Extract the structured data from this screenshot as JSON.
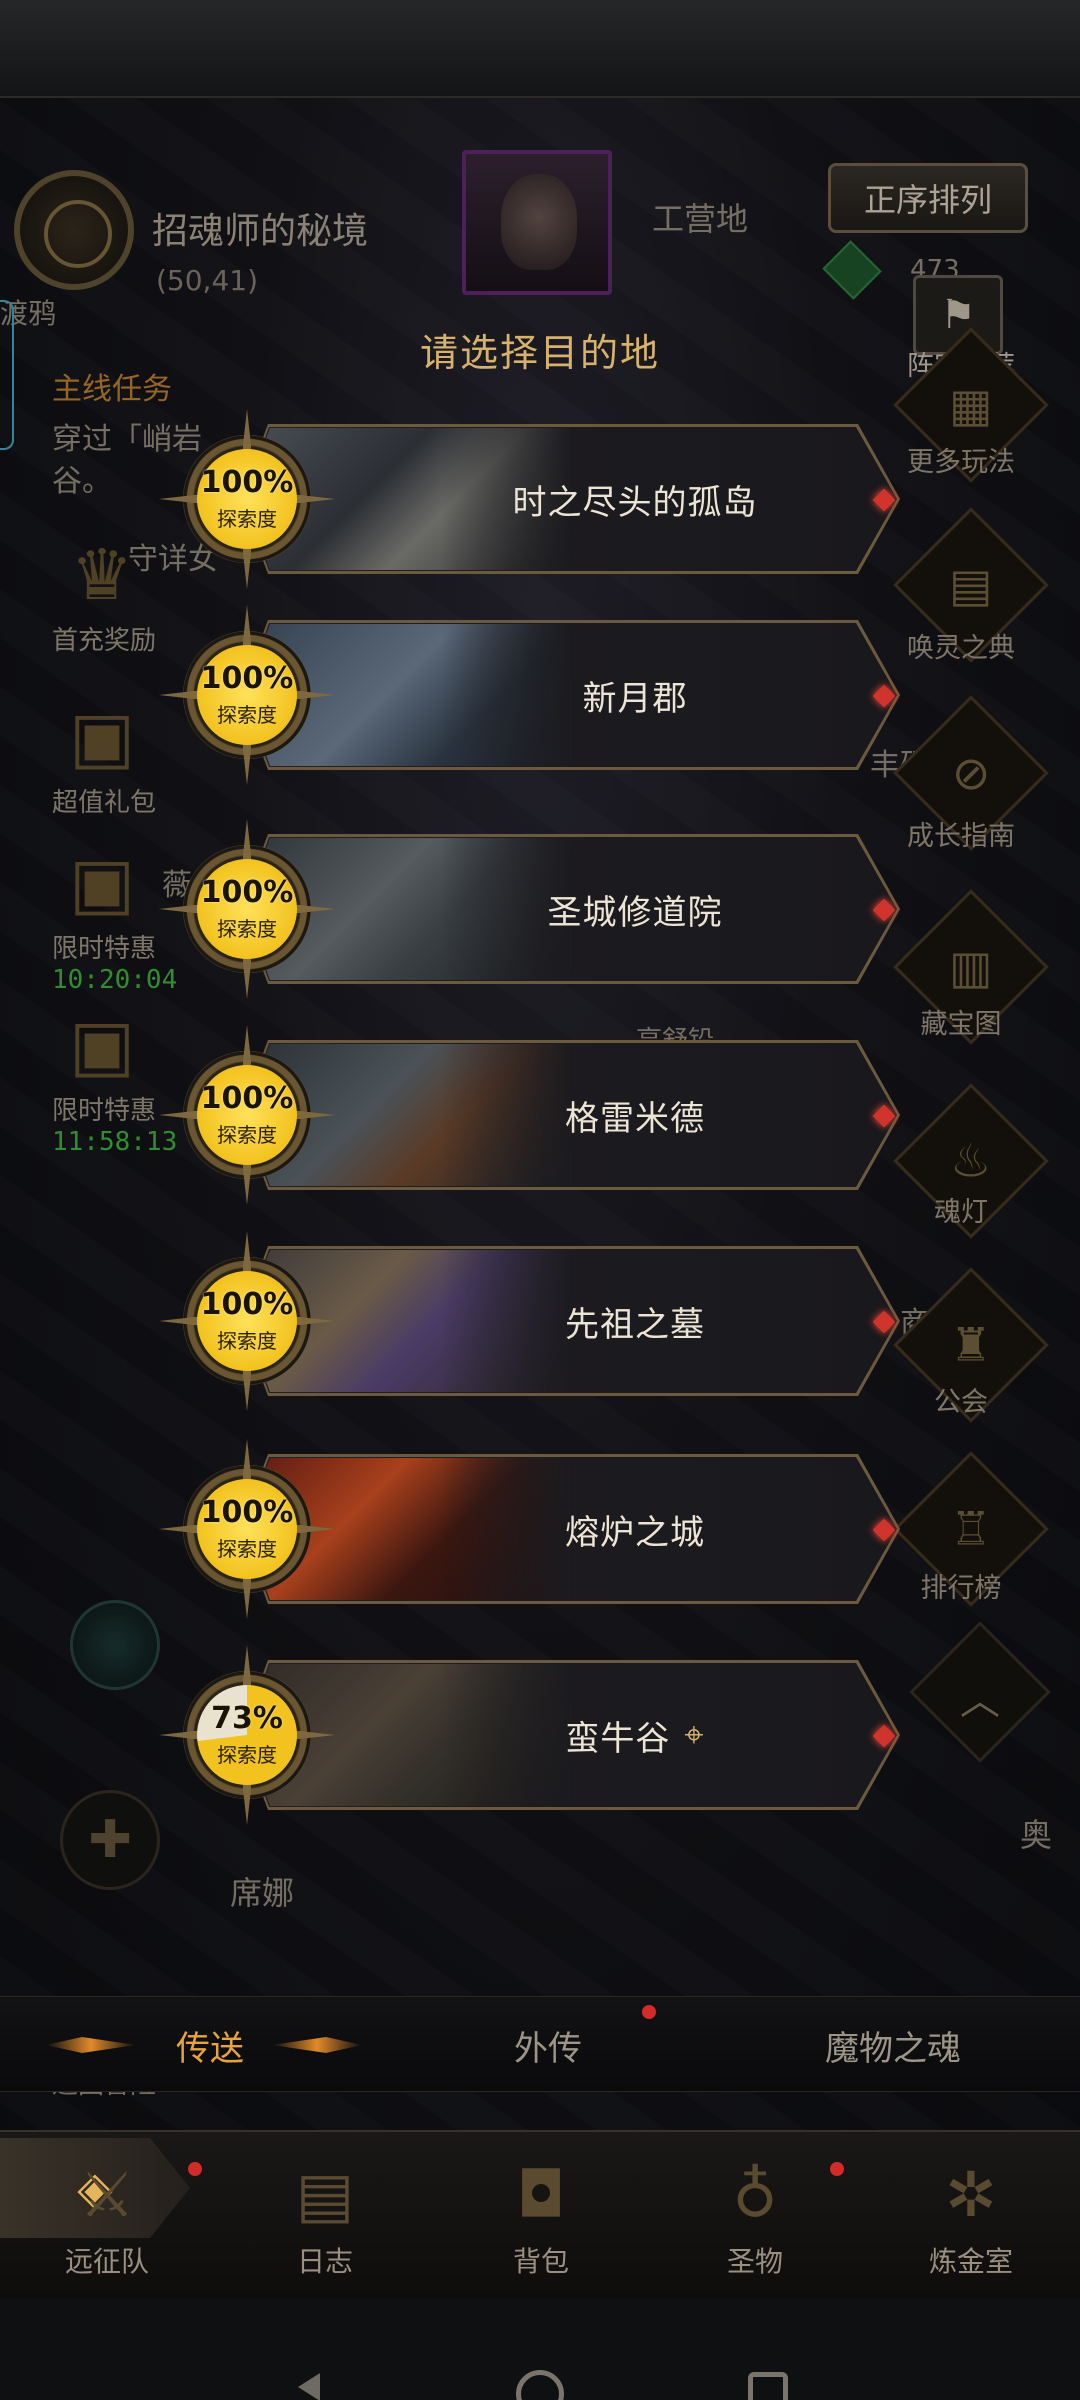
{
  "hud": {
    "location_name": "招魂师的秘境",
    "coords": "(50,41)",
    "partial_left": "渡鸦",
    "camp_label": "工营地",
    "sort_button": "正序排列",
    "partial_number": "473",
    "quest": {
      "title": "主线任务",
      "text_line1": "穿过「峭岩",
      "text_line2": "谷。"
    },
    "partial_texts": [
      "守详女",
      "丰硕",
      "薇",
      "亨舒铅",
      "商",
      "奥",
      "席娜",
      "返回冒险"
    ]
  },
  "left_menu": [
    {
      "label": "首充奖励",
      "icon": "trophy-icon"
    },
    {
      "label": "超值礼包",
      "icon": "gift-box-icon"
    },
    {
      "label": "限时特惠",
      "icon": "gift-box-icon",
      "timer": "10:20:04"
    },
    {
      "label": "限时特惠",
      "icon": "gift-box-icon",
      "timer": "11:58:13"
    }
  ],
  "right_menu": [
    {
      "label": "阵容推荐",
      "icon": "thumbs-up-flag-icon"
    },
    {
      "label": "更多玩法",
      "icon": "gift-icon"
    },
    {
      "label": "唤灵之典",
      "icon": "book-icon"
    },
    {
      "label": "成长指南",
      "icon": "compass-icon"
    },
    {
      "label": "藏宝图",
      "icon": "treasure-map-icon"
    },
    {
      "label": "魂灯",
      "icon": "lamp-icon"
    },
    {
      "label": "公会",
      "icon": "guild-icon"
    },
    {
      "label": "排行榜",
      "icon": "trophy-icon"
    }
  ],
  "dialog": {
    "title": "请选择目的地",
    "explore_label": "探索度",
    "destinations": [
      {
        "name": "时之尽头的孤岛",
        "progress": "100%",
        "value": 100,
        "current": false
      },
      {
        "name": "新月郡",
        "progress": "100%",
        "value": 100,
        "current": false
      },
      {
        "name": "圣城修道院",
        "progress": "100%",
        "value": 100,
        "current": false
      },
      {
        "name": "格雷米德",
        "progress": "100%",
        "value": 100,
        "current": false
      },
      {
        "name": "先祖之墓",
        "progress": "100%",
        "value": 100,
        "current": false
      },
      {
        "name": "熔炉之城",
        "progress": "100%",
        "value": 100,
        "current": false
      },
      {
        "name": "蛮牛谷",
        "progress": "73%",
        "value": 73,
        "current": true
      }
    ]
  },
  "tabs": [
    {
      "label": "传送",
      "active": true
    },
    {
      "label": "外传",
      "active": false
    },
    {
      "label": "魔物之魂",
      "active": false
    }
  ],
  "bottom_nav": [
    {
      "label": "远征队",
      "icon": "expedition-icon"
    },
    {
      "label": "日志",
      "icon": "scroll-icon"
    },
    {
      "label": "背包",
      "icon": "backpack-icon"
    },
    {
      "label": "圣物",
      "icon": "relic-icon"
    },
    {
      "label": "炼金室",
      "icon": "alchemy-icon"
    }
  ],
  "colors": {
    "accent_gold": "#d7b26a",
    "active_tab": "#e8a43a",
    "timer_green": "#3fbf3f",
    "notify_red": "#d32a2a",
    "medal_gold": "#f2c21e"
  }
}
